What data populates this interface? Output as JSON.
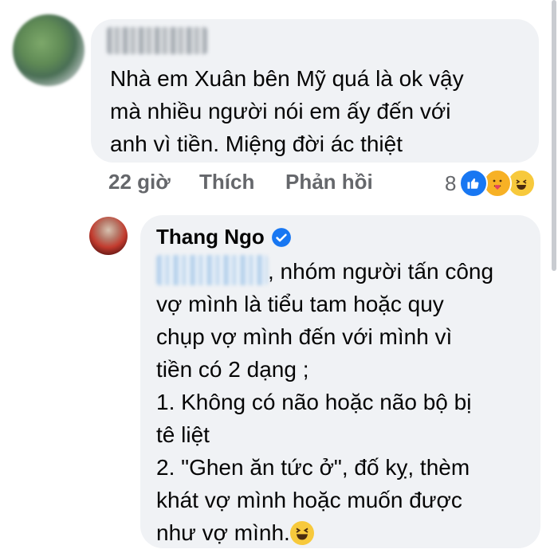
{
  "comment1": {
    "text": "Nhà em Xuân bên Mỹ quá là ok vậy\nmà nhiều người nói em ấy đến với\nanh vì tiền. Miệng đời ác thiệt",
    "time": "22 giờ",
    "like_label": "Thích",
    "reply_label": "Phản hồi",
    "reaction_count": "8",
    "reactions": [
      "like-icon",
      "care-icon",
      "haha-icon"
    ]
  },
  "comment2": {
    "author": "Thang Ngo",
    "verified": true,
    "text_after_mention": ", nhóm người tấn công\nvợ mình là tiểu tam hoặc quy\nchụp vợ mình đến với mình vì\ntiền có 2 dạng ;\n1. Không có não hoặc não bộ bị\ntê liệt\n2. \"Ghen ăn tức ở\", đố kỵ, thèm\nkhát vợ mình hoặc muốn được\nnhư vợ mình.",
    "emoji": "haha-icon"
  },
  "colors": {
    "bubble": "#f0f2f5",
    "meta_text": "#65676b",
    "like_blue": "#1877f2",
    "verified_blue": "#1877f2"
  }
}
